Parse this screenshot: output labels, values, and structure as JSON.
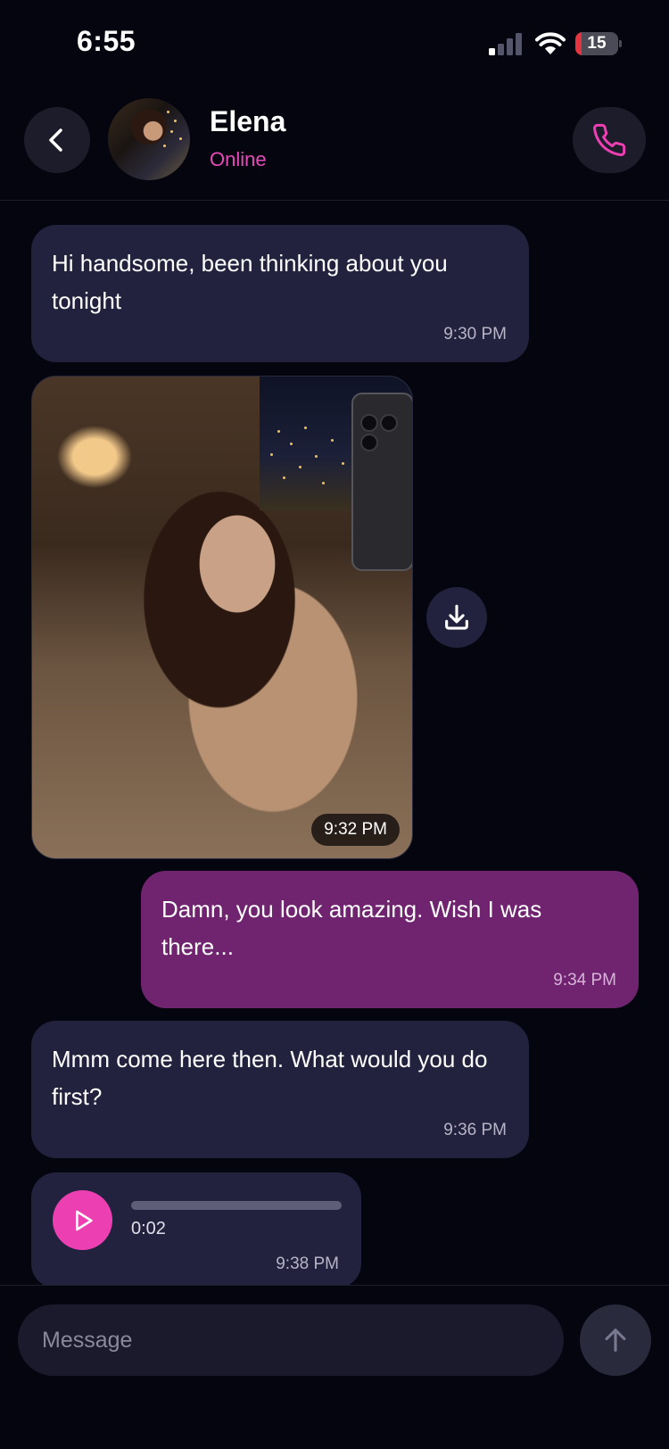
{
  "status_bar": {
    "time": "6:55",
    "battery_level": "15",
    "battery_fraction": 0.15,
    "signal_bars_active": 1,
    "signal_bars_total": 4
  },
  "header": {
    "contact_name": "Elena",
    "contact_status": "Online",
    "back_icon": "chevron-left-icon",
    "call_icon": "phone-icon"
  },
  "messages": [
    {
      "direction": "incoming",
      "type": "text",
      "text": "Hi handsome, been thinking about you tonight",
      "time": "9:30 PM"
    },
    {
      "direction": "incoming",
      "type": "image",
      "time": "9:32 PM",
      "action_icon": "download-icon"
    },
    {
      "direction": "outgoing",
      "type": "text",
      "text": "Damn, you look amazing. Wish I was there...",
      "time": "9:34 PM"
    },
    {
      "direction": "incoming",
      "type": "text",
      "text": "Mmm come here then. What would you do first?",
      "time": "9:36 PM"
    },
    {
      "direction": "incoming",
      "type": "voice",
      "duration": "0:02",
      "time": "9:38 PM",
      "progress": 0
    }
  ],
  "composer": {
    "placeholder": "Message",
    "value": "",
    "send_icon": "arrow-up-icon"
  },
  "colors": {
    "background": "#05050f",
    "incoming_bubble": "#22223e",
    "outgoing_bubble": "#702470",
    "accent": "#ec3fb2",
    "online_status": "#e54bb8"
  }
}
